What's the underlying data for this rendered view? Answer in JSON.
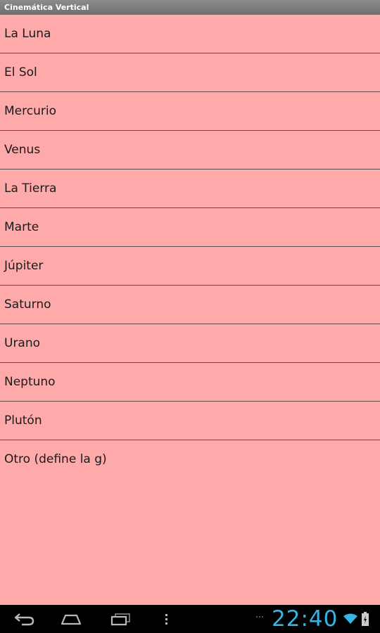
{
  "app": {
    "title": "Cinemática Vertical"
  },
  "list": {
    "items": [
      {
        "label": "La Luna"
      },
      {
        "label": "El Sol"
      },
      {
        "label": "Mercurio"
      },
      {
        "label": "Venus"
      },
      {
        "label": "La Tierra"
      },
      {
        "label": "Marte"
      },
      {
        "label": "Júpiter"
      },
      {
        "label": "Saturno"
      },
      {
        "label": "Urano"
      },
      {
        "label": "Neptuno"
      },
      {
        "label": "Plutón"
      },
      {
        "label": "Otro (define la g)"
      }
    ]
  },
  "system_bar": {
    "clock": "22:40",
    "icons": [
      "back-icon",
      "home-icon",
      "recent-apps-icon",
      "menu-icon",
      "wifi-icon",
      "battery-icon"
    ]
  },
  "colors": {
    "background": "#ffaaaa",
    "divider": "#5e5050",
    "clock": "#33b5e5",
    "titlebar": "#7a7a7a"
  }
}
